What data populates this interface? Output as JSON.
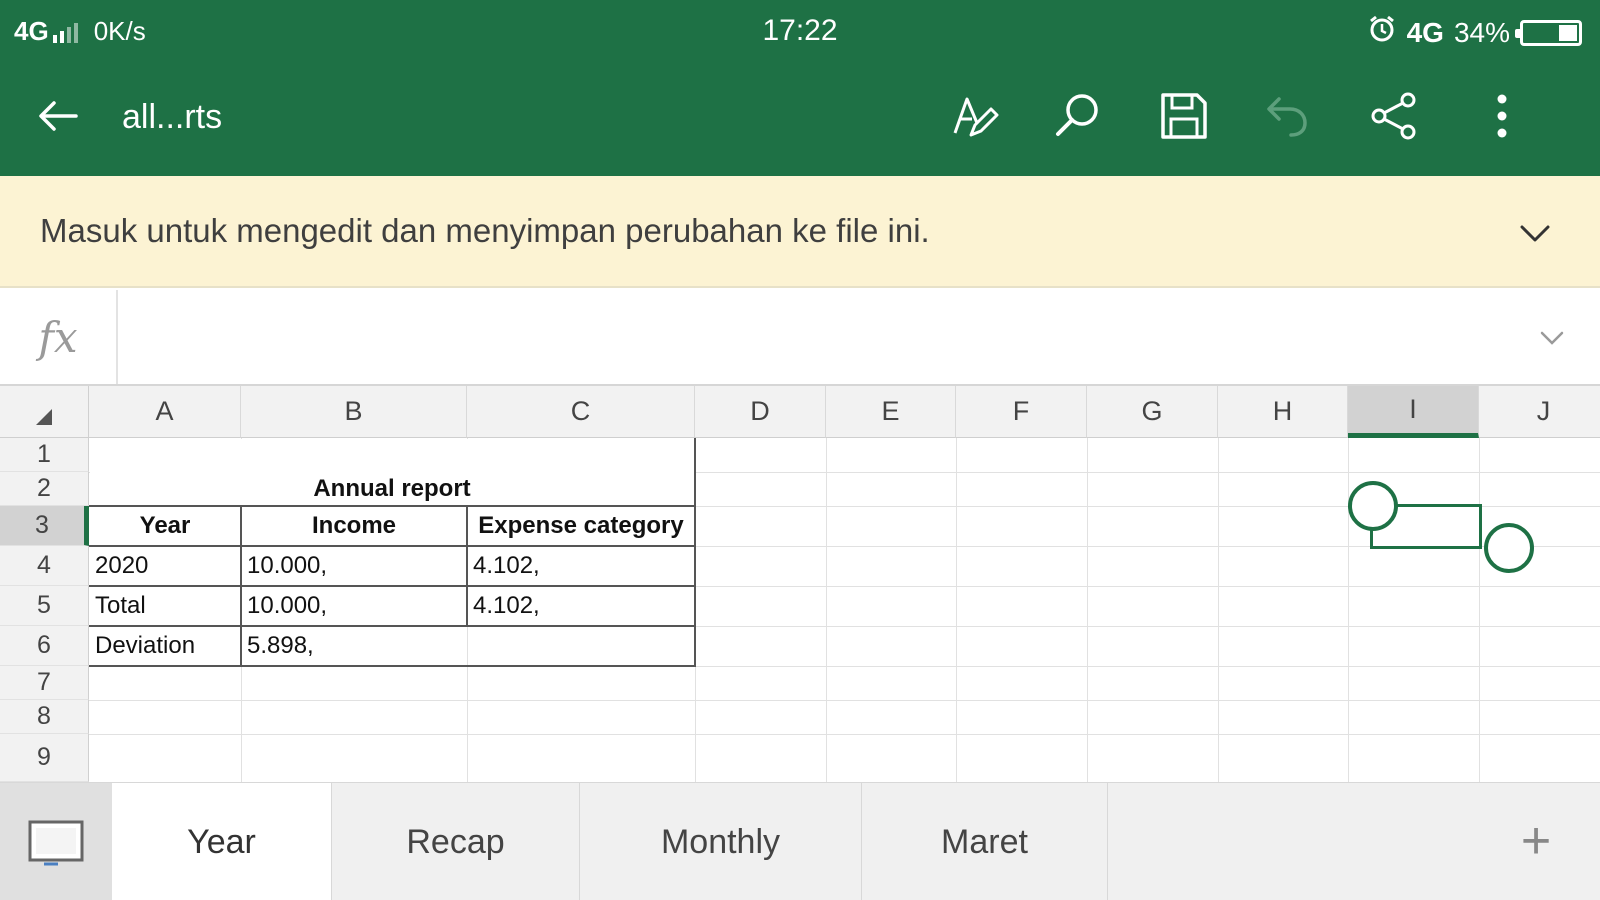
{
  "status_bar": {
    "network": "4G",
    "speed": "0K/s",
    "time": "17:22",
    "mobile_data": "4G",
    "battery_percent": "34%",
    "battery_level": 0.34
  },
  "app_bar": {
    "title": "all...rts",
    "icons": [
      "back-arrow-icon",
      "draw-icon",
      "search-icon",
      "save-icon",
      "undo-icon",
      "share-icon",
      "more-icon"
    ]
  },
  "banner": {
    "message": "Masuk untuk mengedit dan menyimpan perubahan ke file ini."
  },
  "formula_bar": {
    "fx_label": "fx",
    "value": ""
  },
  "grid": {
    "columns": [
      "A",
      "B",
      "C",
      "D",
      "E",
      "F",
      "G",
      "H",
      "I",
      "J"
    ],
    "rows": [
      "1",
      "2",
      "3",
      "4",
      "5",
      "6",
      "7",
      "8",
      "9"
    ],
    "active_column": "I",
    "active_row": "3",
    "cells": {
      "title": "Annual report",
      "header_year": "Year",
      "header_income": "Income",
      "header_expense": "Expense category",
      "r4_a": "2020",
      "r4_b": "10.000,",
      "r4_c": "4.102,",
      "r5_a": "Total",
      "r5_b": "10.000,",
      "r5_c": "4.102,",
      "r6_a": "Deviation",
      "r6_b": "5.898,"
    }
  },
  "sheet_tabs": {
    "tabs": [
      "Year",
      "Recap",
      "Monthly",
      "Maret"
    ],
    "active": "Year",
    "add_label": "+"
  },
  "colors": {
    "brand_green": "#1e7145",
    "banner_bg": "#fcf3d3"
  }
}
